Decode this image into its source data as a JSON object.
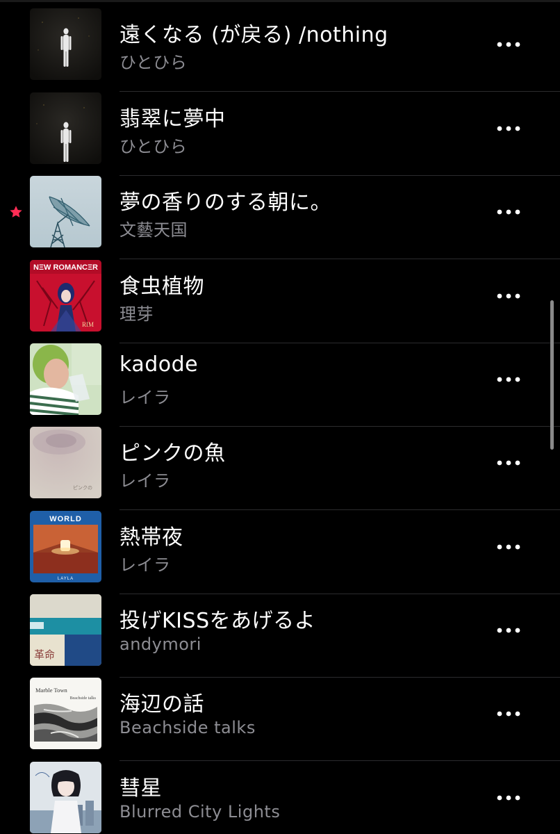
{
  "tracks": [
    {
      "title": "遠くなる (が戻る) /nothing",
      "artist": "ひとひら",
      "art": "figure-dark-icon",
      "starred": false
    },
    {
      "title": "翡翠に夢中",
      "artist": "ひとひら",
      "art": "figure-dark-icon",
      "starred": false
    },
    {
      "title": "夢の香りのする朝に。",
      "artist": "文藝天国",
      "art": "satellite-dish-icon",
      "starred": true
    },
    {
      "title": "食虫植物",
      "artist": "理芽",
      "art": "new-romancer-cover",
      "starred": false
    },
    {
      "title": "kadode",
      "artist": "レイラ",
      "art": "photo-girl-cover",
      "starred": false
    },
    {
      "title": "ピンクの魚",
      "artist": "レイラ",
      "art": "pink-fish-cover",
      "starred": false
    },
    {
      "title": "熱帯夜",
      "artist": "レイラ",
      "art": "world-cover",
      "starred": false
    },
    {
      "title": "投げKISSをあげるよ",
      "artist": "andymori",
      "art": "kakumei-cover",
      "starred": false
    },
    {
      "title": "海辺の話",
      "artist": "Beachside talks",
      "art": "marble-town-cover",
      "starred": false
    },
    {
      "title": "彗星",
      "artist": "Blurred City Lights",
      "art": "anime-girl-cover",
      "starred": false
    }
  ],
  "covers": {
    "new_romancer_text": "NΞW ROMANCΞR",
    "new_romancer_mark": "RIM",
    "pink_fish_caption": "ピンクの",
    "world_title": "WORLD",
    "world_artist": "LAYLA",
    "kakumei_text": "革命",
    "marble_title": "Marble Town",
    "marble_sub": "Beachside talks"
  },
  "colors": {
    "background": "#000000",
    "title": "#ffffff",
    "subtitle": "#8d8d93",
    "separator": "#2c2c2e",
    "star": "#ff2d55"
  }
}
